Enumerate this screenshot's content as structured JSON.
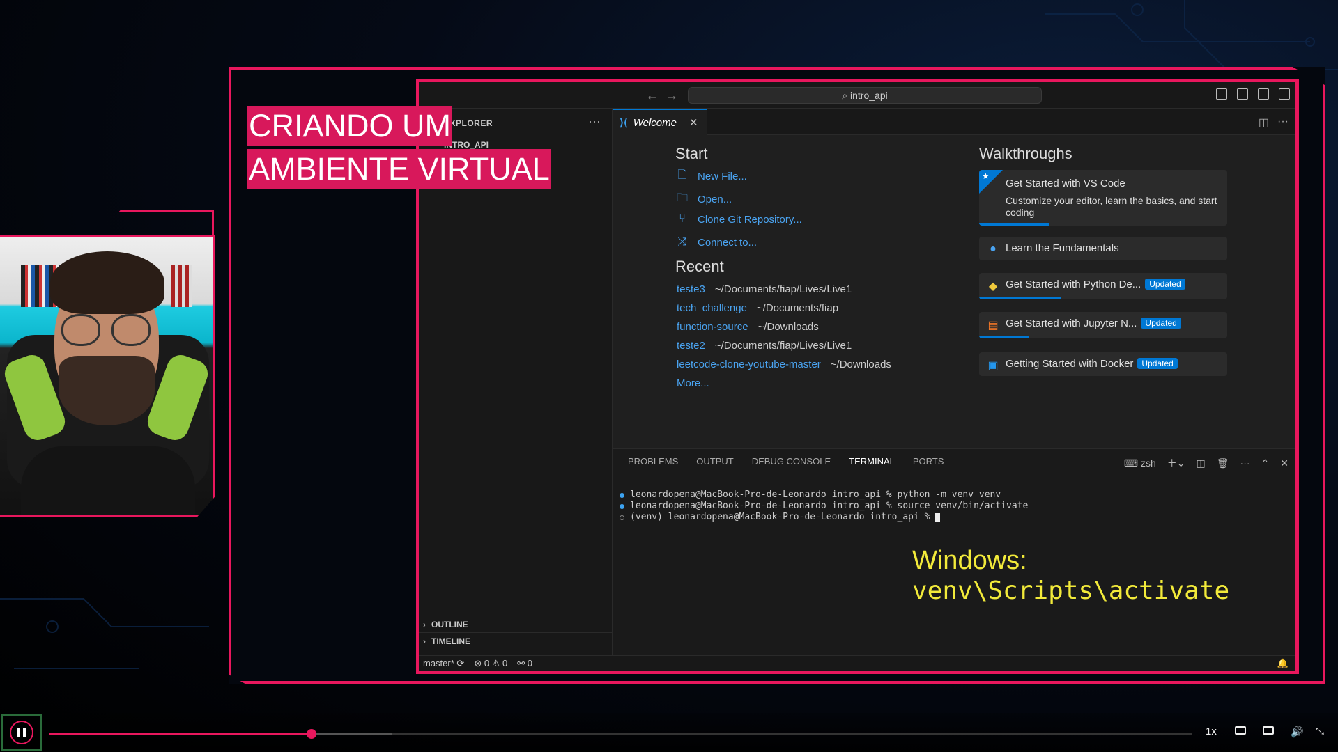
{
  "title_overlay": {
    "line1": "CRIANDO UM",
    "line2": "AMBIENTE VIRTUAL"
  },
  "vscode": {
    "search": "intro_api",
    "explorer_header": "EXPLORER",
    "explorer_project": "INTRO_API",
    "sections": [
      "OUTLINE",
      "TIMELINE"
    ],
    "tab": {
      "label": "Welcome"
    },
    "start": {
      "heading": "Start",
      "items": [
        "New File...",
        "Open...",
        "Clone Git Repository...",
        "Connect to..."
      ]
    },
    "recent": {
      "heading": "Recent",
      "items": [
        {
          "name": "teste3",
          "path": "~/Documents/fiap/Lives/Live1"
        },
        {
          "name": "tech_challenge",
          "path": "~/Documents/fiap"
        },
        {
          "name": "function-source",
          "path": "~/Downloads"
        },
        {
          "name": "teste2",
          "path": "~/Documents/fiap/Lives/Live1"
        },
        {
          "name": "leetcode-clone-youtube-master",
          "path": "~/Downloads"
        }
      ],
      "more": "More..."
    },
    "walkthroughs": {
      "heading": "Walkthroughs",
      "items": [
        {
          "title": "Get Started with VS Code",
          "desc": "Customize your editor, learn the basics, and start coding",
          "progress": 0.28
        },
        {
          "title": "Learn the Fundamentals"
        },
        {
          "title": "Get Started with Python De...",
          "badge": "Updated",
          "progress": 0.33
        },
        {
          "title": "Get Started with Jupyter N...",
          "badge": "Updated",
          "progress": 0.2
        },
        {
          "title": "Getting Started with Docker",
          "badge": "Updated"
        }
      ]
    },
    "panel": {
      "tabs": [
        "PROBLEMS",
        "OUTPUT",
        "DEBUG CONSOLE",
        "TERMINAL",
        "PORTS"
      ],
      "active_tab": "TERMINAL",
      "shell": "zsh",
      "terminal_lines": [
        "leonardopena@MacBook-Pro-de-Leonardo intro_api % python -m venv venv",
        "leonardopena@MacBook-Pro-de-Leonardo intro_api % source venv/bin/activate",
        "(venv) leonardopena@MacBook-Pro-de-Leonardo intro_api % "
      ],
      "note_line1": "Windows:",
      "note_line2": "venv\\Scripts\\activate"
    },
    "status": {
      "branch": "master*",
      "errors": "0",
      "warnings": "0",
      "ports": "0"
    }
  },
  "player": {
    "speed": "1x",
    "progress": 0.23,
    "buffered": 0.3
  },
  "colors": {
    "accent": "#e8175d",
    "vscode_blue": "#0078d4",
    "note_yellow": "#f2ea3a"
  }
}
